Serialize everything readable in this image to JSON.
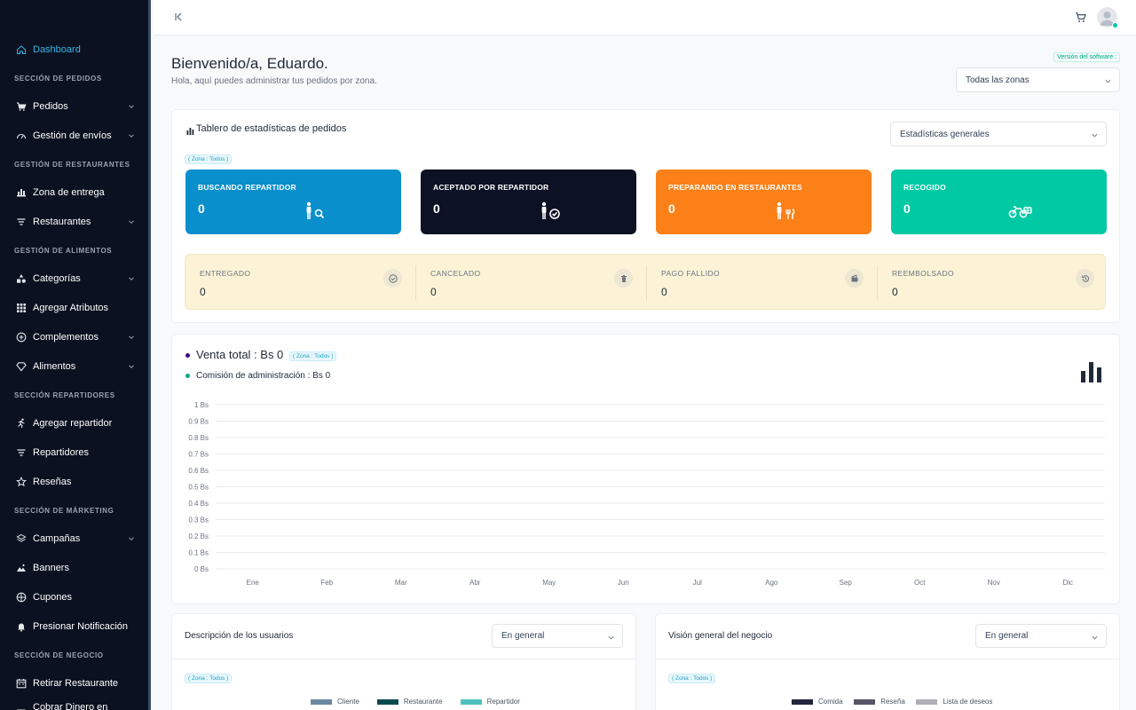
{
  "sidebar": {
    "items": [
      {
        "label": "Dashboard",
        "icon": "home-icon",
        "chevron": false,
        "active": true
      },
      {
        "section": "SECCIÓN DE PEDIDOS"
      },
      {
        "label": "Pedidos",
        "icon": "cart-icon",
        "chevron": true
      },
      {
        "label": "Gestión de envíos",
        "icon": "speedometer-icon",
        "chevron": true
      },
      {
        "section": "GESTIÓN DE RESTAURANTES"
      },
      {
        "label": "Zona de entrega",
        "icon": "map-icon",
        "chevron": false
      },
      {
        "label": "Restaurantes",
        "icon": "filter-list-icon",
        "chevron": true
      },
      {
        "section": "GESTIÓN DE ALIMENTOS"
      },
      {
        "label": "Categorías",
        "icon": "category-icon",
        "chevron": true
      },
      {
        "label": "Agregar Atributos",
        "icon": "grid-icon",
        "chevron": false
      },
      {
        "label": "Complementos",
        "icon": "plus-circle-icon",
        "chevron": true
      },
      {
        "label": "Alimentos",
        "icon": "diamond-icon",
        "chevron": true
      },
      {
        "section": "SECCIÓN REPARTIDORES"
      },
      {
        "label": "Agregar repartidor",
        "icon": "running-person-icon",
        "chevron": false
      },
      {
        "label": "Repartidores",
        "icon": "filter-list-icon",
        "chevron": false
      },
      {
        "label": "Reseñas",
        "icon": "star-icon",
        "chevron": false
      },
      {
        "section": "SECCIÓN DE MÁRKETING"
      },
      {
        "label": "Campañas",
        "icon": "layers-icon",
        "chevron": true
      },
      {
        "label": "Banners",
        "icon": "mountain-icon",
        "chevron": false
      },
      {
        "label": "Cupones",
        "icon": "gift-icon",
        "chevron": false
      },
      {
        "label": "Presionar Notificación",
        "icon": "bell-icon",
        "chevron": false
      },
      {
        "section": "SECCIÓN DE NEGOCIO"
      },
      {
        "label": "Retirar Restaurante",
        "icon": "calendar-icon",
        "chevron": false
      },
      {
        "label": "Cobrar Dinero en efectivo",
        "icon": "cash-icon",
        "chevron": false
      }
    ]
  },
  "header": {
    "welcome": "Bienvenido/a, Eduardo.",
    "subtitle": "Hola, aquí puedes administrar tus pedidos por zona.",
    "version": "Versión del software :",
    "zone_select": "Todas las zonas"
  },
  "orders_card": {
    "title": "Tablero de estadísticas de pedidos",
    "select": "Estadísticas generales",
    "zone_badge": "( Zona : Todos )",
    "stats": [
      {
        "label": "BUSCANDO REPARTIDOR",
        "value": "0",
        "color": "#0a8fcd",
        "icon": "person-search-icon"
      },
      {
        "label": "ACEPTADO POR REPARTIDOR",
        "value": "0",
        "color": "#0c1124",
        "icon": "person-check-icon"
      },
      {
        "label": "PREPARANDO EN RESTAURANTES",
        "value": "0",
        "color": "#fb8018",
        "icon": "person-cutlery-icon"
      },
      {
        "label": "RECOGIDO",
        "value": "0",
        "color": "#00c9a3",
        "icon": "bike-icon"
      }
    ],
    "sub_stats": [
      {
        "label": "ENTREGADO",
        "value": "0",
        "icon": "check-circle-icon"
      },
      {
        "label": "CANCELADO",
        "value": "0",
        "icon": "trash-icon"
      },
      {
        "label": "PAGO FALLIDO",
        "value": "0",
        "icon": "wallet-icon"
      },
      {
        "label": "REEMBOLSADO",
        "value": "0",
        "icon": "history-icon"
      }
    ]
  },
  "sales_card": {
    "total_label": "Venta total : Bs 0",
    "zone_badge": "( Zona : Todos )",
    "commission_label": "Comisión de administración : Bs 0",
    "dot_total_color": "#3f0a7a",
    "dot_commission_color": "#00a98a"
  },
  "chart_data": {
    "type": "bar",
    "categories": [
      "Ene",
      "Feb",
      "Mar",
      "Abr",
      "May",
      "Jun",
      "Jul",
      "Ago",
      "Sep",
      "Oct",
      "Nov",
      "Dic"
    ],
    "series": [
      {
        "values": [
          0,
          0,
          0,
          0,
          0,
          0,
          0,
          0,
          0,
          0,
          0,
          0
        ]
      },
      {
        "values": [
          0,
          0,
          0,
          0,
          0,
          0,
          0,
          0,
          0,
          0,
          0,
          0
        ]
      }
    ],
    "yticks": [
      "1 Bs",
      "0.9 Bs",
      "0.8 Bs",
      "0.7 Bs",
      "0.6 Bs",
      "0.5 Bs",
      "0.4 Bs",
      "0.3 Bs",
      "0.2 Bs",
      "0.1 Bs",
      "0 Bs"
    ],
    "ylim": [
      0,
      1
    ],
    "grid": true
  },
  "users_card": {
    "title": "Descripción de los usuarios",
    "select": "En general",
    "zone_badge": "( Zona : Todos )",
    "legend": [
      {
        "label": "Cliente",
        "color": "#6c87a0"
      },
      {
        "label": "Restaurante",
        "color": "#0b4a4d"
      },
      {
        "label": "Repartidor",
        "color": "#4fc0c0"
      }
    ]
  },
  "business_card": {
    "title": "Visión general del negocio",
    "select": "En general",
    "zone_badge": "( Zona : Todos )",
    "legend": [
      {
        "label": "Comida",
        "color": "#23263a"
      },
      {
        "label": "Reseña",
        "color": "#565467"
      },
      {
        "label": "Lista de deseos",
        "color": "#b0afb8"
      }
    ]
  }
}
